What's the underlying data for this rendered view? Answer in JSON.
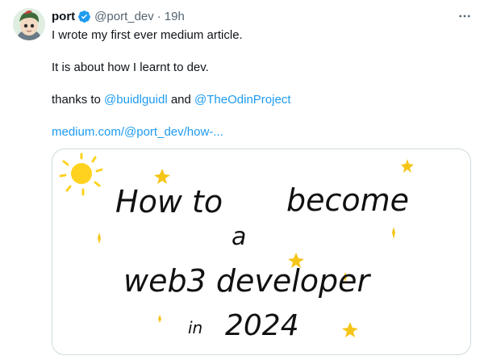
{
  "author": {
    "display_name": "port",
    "handle": "@port_dev",
    "separator": "·",
    "time": "19h",
    "verified": true,
    "avatar": "avatar-image"
  },
  "menu_icon": "more-dots-icon",
  "tweet": {
    "line1": "I wrote my first ever medium article.",
    "line2": "It is about how I learnt to dev.",
    "thanks_prefix": "thanks to",
    "mention1": "@buidlguidl",
    "and": "and",
    "mention2": "@TheOdinProject",
    "link": "medium.com/@port_dev/how-..."
  },
  "media": {
    "line1_left": "How to",
    "line1_right": "become",
    "line2": "a",
    "line3": "web3 developer",
    "line4_small": "in",
    "line4_year": "2024"
  },
  "colors": {
    "link": "#1d9bf0",
    "verified": "#1d9bf0",
    "sun": "#ffd21f",
    "star": "#f5c518",
    "muted": "#536471"
  }
}
